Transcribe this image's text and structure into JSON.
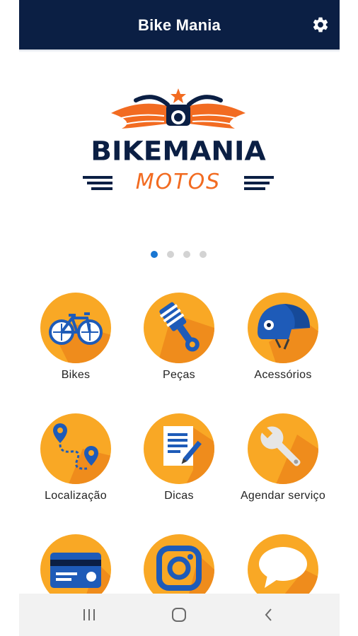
{
  "app": {
    "title": "Bike Mania"
  },
  "header": {
    "settings_icon": "gear-icon"
  },
  "logo": {
    "word": "BIKEMANIA",
    "sub": "MOTOS"
  },
  "carousel": {
    "pages": 4,
    "active_index": 0
  },
  "menu": {
    "items": [
      {
        "label": "Bikes",
        "icon": "bicycle-icon"
      },
      {
        "label": "Peças",
        "icon": "piston-icon"
      },
      {
        "label": "Acessórios",
        "icon": "helmet-icon"
      },
      {
        "label": "Localização",
        "icon": "map-route-icon"
      },
      {
        "label": "Dicas",
        "icon": "document-edit-icon"
      },
      {
        "label": "Agendar serviço",
        "icon": "wrench-icon"
      },
      {
        "label": "",
        "icon": "credit-card-icon"
      },
      {
        "label": "",
        "icon": "instagram-icon"
      },
      {
        "label": "",
        "icon": "chat-bubble-icon"
      }
    ]
  },
  "system_nav": {
    "recents": "recents-icon",
    "home": "home-icon",
    "back": "back-icon"
  },
  "colors": {
    "header": "#0b1f44",
    "tile": "#f9a825",
    "accent": "#f26b21",
    "dot_active": "#1976d2"
  }
}
